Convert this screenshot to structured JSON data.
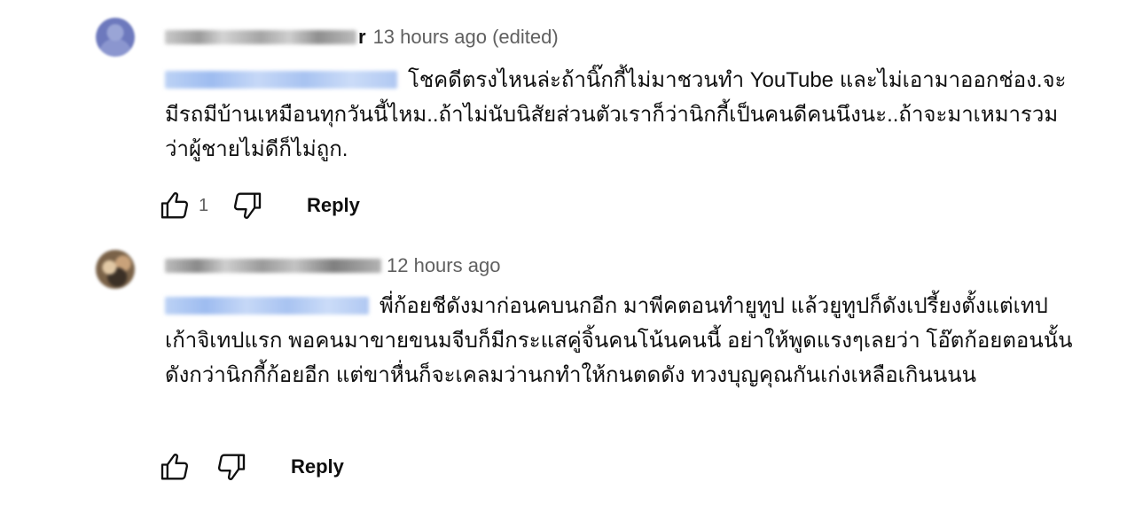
{
  "comments": [
    {
      "author_visible_suffix": "r",
      "timestamp": "13 hours ago (edited)",
      "text": "โชคดีตรงไหนล่ะถ้านิ๊กกี้ไม่มาชวนทำ YouTube และไม่เอามาออกช่อง.จะมีรถมีบ้านเหมือนทุกวันนี้ไหม..ถ้าไม่นับนิสัยส่วนตัวเราก็ว่านิกกี้เป็นคนดีคนนึงนะ..ถ้าจะมาเหมารวมว่าผู้ชายไม่ดีก็ไม่ถูก.",
      "like_count": "1",
      "reply_label": "Reply",
      "avatar_icon": "user-avatar",
      "like_icon": "thumbs-up-icon",
      "dislike_icon": "thumbs-down-icon"
    },
    {
      "author_visible_suffix": "",
      "timestamp": "12 hours ago",
      "text": "พี่ก้อยชีดังมาก่อนคบนกอีก มาพีคตอนทำยูทูป แล้วยูทูปก็ดังเปรี้ยงตั้งแต่เทปเก้าจิเทปแรก พอคนมาขายขนมจีบก็มีกระแสคู่จิ้นคนโน้นคนนี้ อย่าให้พูดแรงๆเลยว่า โอ๊ตก้อยตอนนั้นดังกว่านิกกี้ก้อยอีก แต่ขาหื่นก็จะเคลมว่านกทำให้กนตดดัง ทวงบุญคุณกันเก่งเหลือเกินนนน",
      "like_count": "",
      "reply_label": "Reply",
      "avatar_icon": "user-avatar",
      "like_icon": "thumbs-up-icon",
      "dislike_icon": "thumbs-down-icon"
    }
  ],
  "colors": {
    "text_primary": "#0f0f0f",
    "text_secondary": "#606060",
    "background": "#ffffff"
  }
}
